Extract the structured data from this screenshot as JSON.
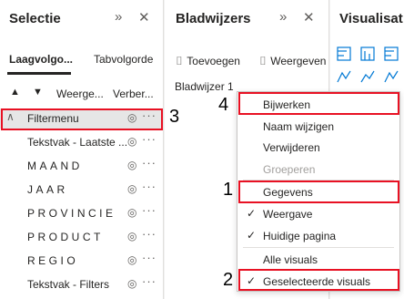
{
  "selection_pane": {
    "title": "Selectie",
    "expand_icon": "»",
    "close_icon": "✕",
    "tabs": [
      {
        "label": "Laagvolgo...",
        "active": true
      },
      {
        "label": "Tabvolgorde",
        "active": false
      }
    ],
    "toolbar": {
      "up": "▲",
      "down": "▼",
      "show": "Weerge...",
      "hide": "Verber..."
    },
    "items": [
      {
        "label": "Filtermenu",
        "expanded": true,
        "highlighted": true
      },
      {
        "label": "Tekstvak - Laatste ..."
      },
      {
        "label": "MAAND"
      },
      {
        "label": "JAAR"
      },
      {
        "label": "PROVINCIE"
      },
      {
        "label": "PRODUCT"
      },
      {
        "label": "REGIO"
      },
      {
        "label": "Tekstvak - Filters"
      }
    ],
    "eye_icon": "◎",
    "more_icon": "···"
  },
  "bookmarks_pane": {
    "title": "Bladwijzers",
    "expand_icon": "»",
    "close_icon": "✕",
    "add_label": "Toevoegen",
    "view_label": "Weergeven",
    "bookmark_name": "Bladwijzer 1"
  },
  "visualizations_pane": {
    "title": "Visualisat"
  },
  "context_menu": {
    "items": [
      {
        "label": "Bijwerken",
        "highlight": true
      },
      {
        "label": "Naam wijzigen"
      },
      {
        "label": "Verwijderen"
      },
      {
        "label": "Groeperen",
        "disabled": true
      },
      {
        "label": "Gegevens",
        "highlight": true
      },
      {
        "label": "Weergave",
        "checked": true
      },
      {
        "label": "Huidige pagina",
        "checked": true
      },
      {
        "label": "Alle visuals"
      },
      {
        "label": "Geselecteerde visuals",
        "checked": true,
        "highlight": true
      }
    ]
  },
  "annotations": {
    "n1": "1",
    "n2": "2",
    "n3": "3",
    "n4": "4"
  },
  "colors": {
    "highlight_border": "#e81123",
    "selected_row_bg": "#e6e6e6",
    "accent": "#0078d4"
  }
}
